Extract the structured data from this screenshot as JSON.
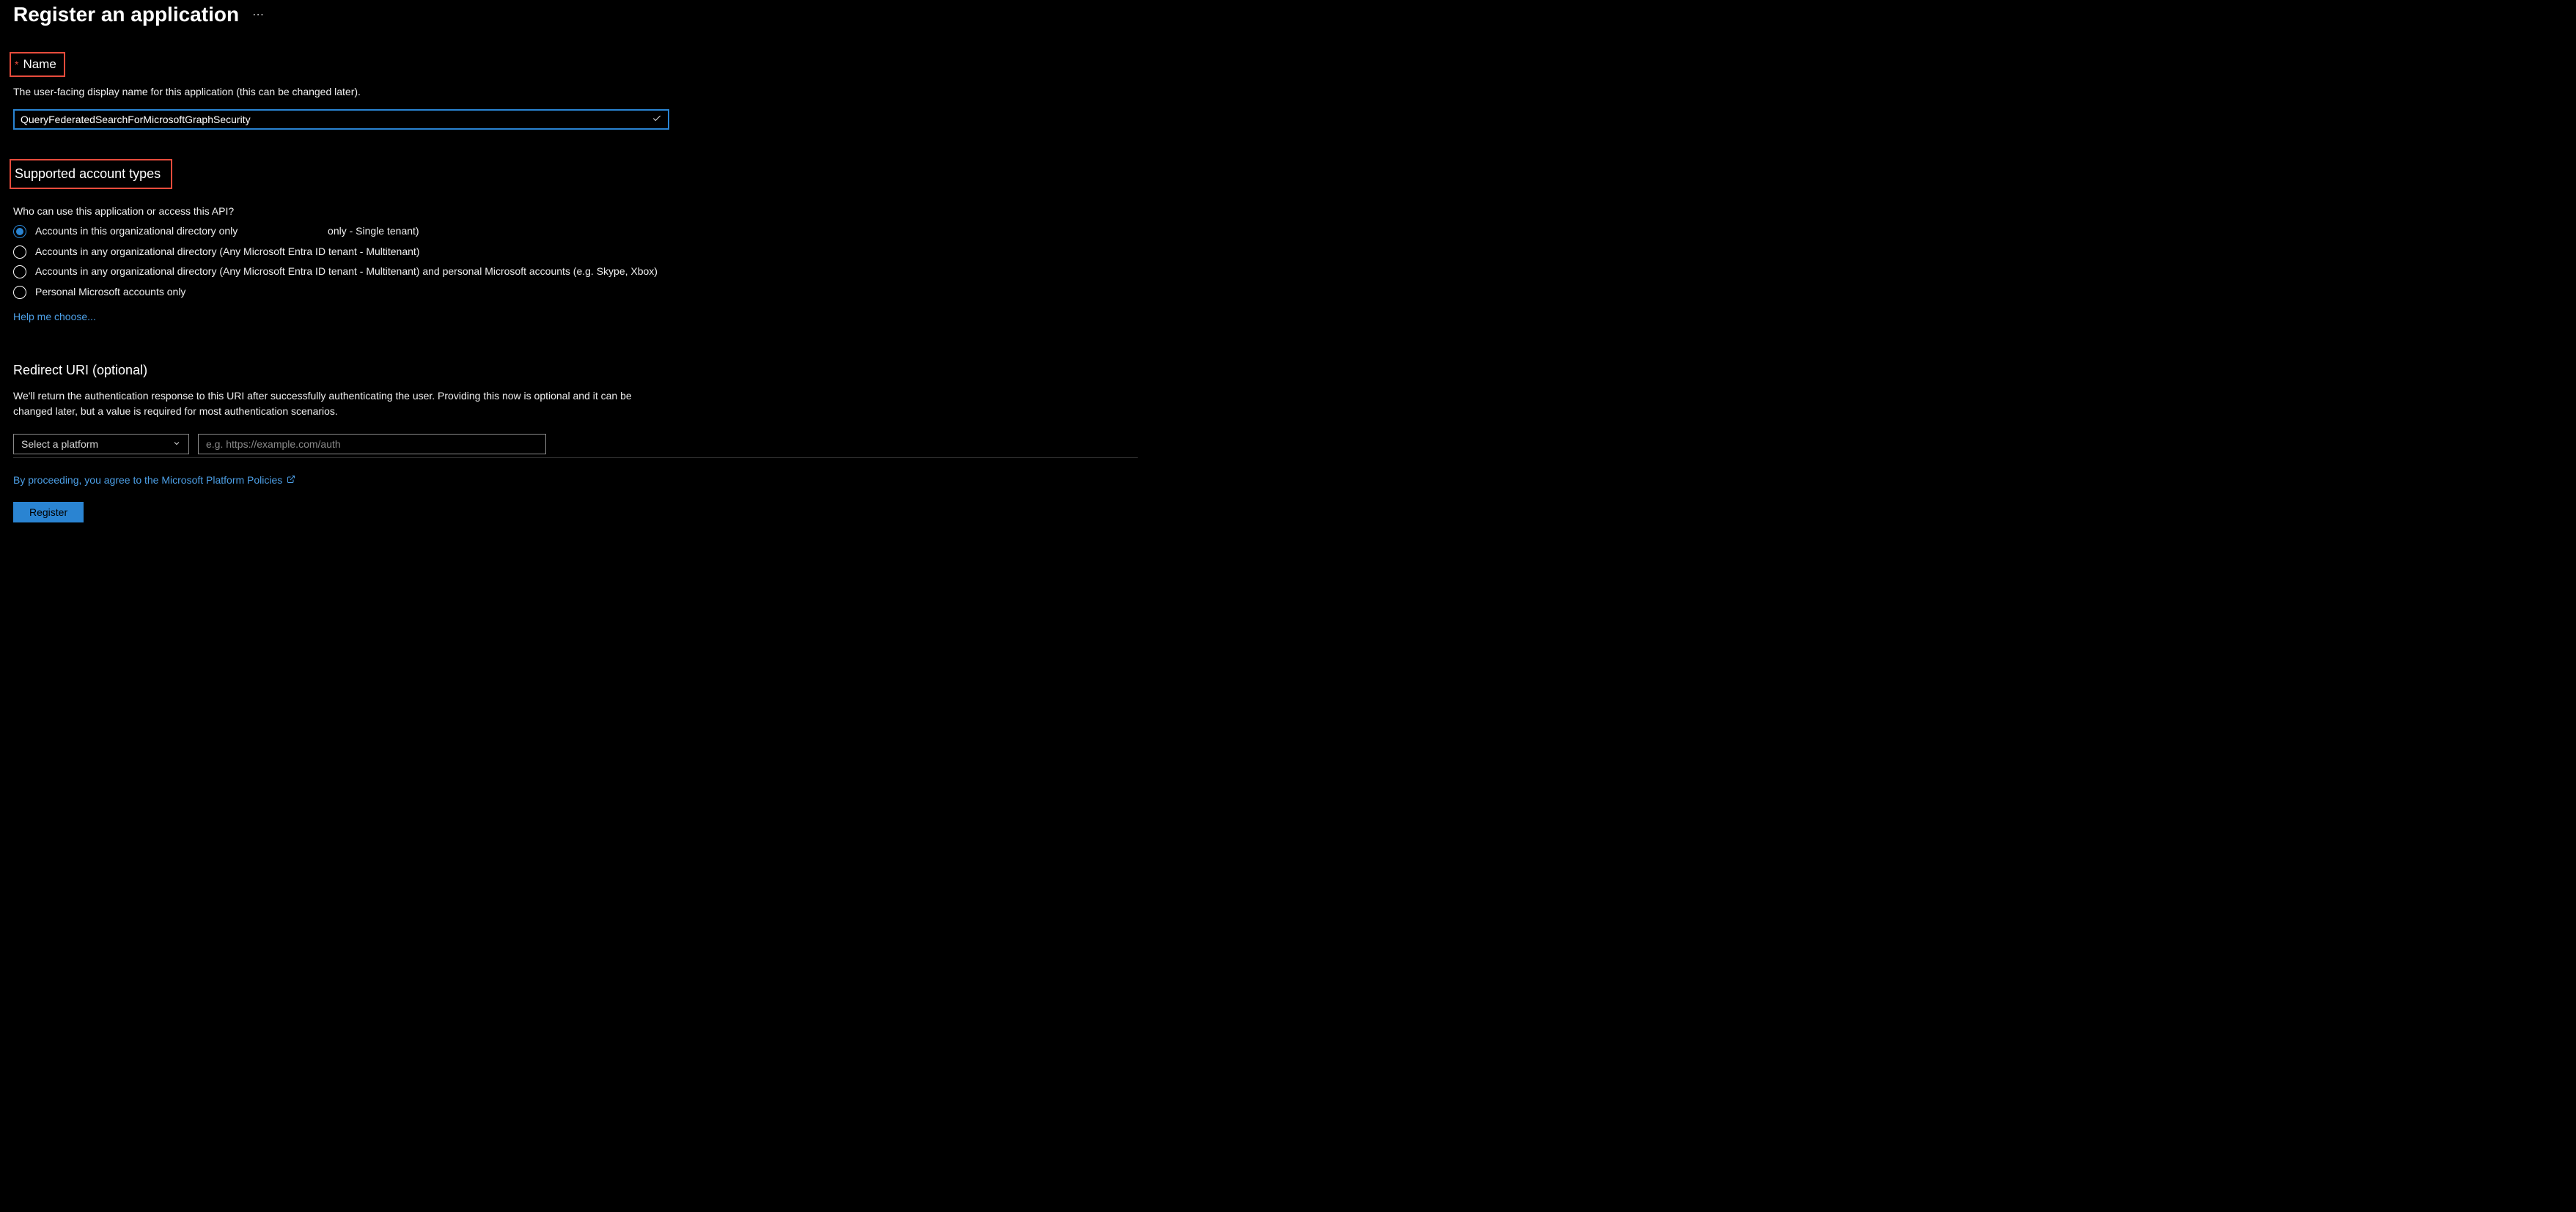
{
  "page": {
    "title": "Register an application"
  },
  "name_section": {
    "label": "Name",
    "hint": "The user-facing display name for this application (this can be changed later).",
    "value": "QueryFederatedSearchForMicrosoftGraphSecurity"
  },
  "accounts_section": {
    "heading": "Supported account types",
    "question": "Who can use this application or access this API?",
    "options": [
      {
        "label_prefix": "Accounts in this organizational directory only ",
        "label_suffix": " only - Single tenant)",
        "selected": true
      },
      {
        "label": "Accounts in any organizational directory (Any Microsoft Entra ID tenant - Multitenant)",
        "selected": false
      },
      {
        "label": "Accounts in any organizational directory (Any Microsoft Entra ID tenant - Multitenant) and personal Microsoft accounts (e.g. Skype, Xbox)",
        "selected": false
      },
      {
        "label": "Personal Microsoft accounts only",
        "selected": false
      }
    ],
    "help_link": "Help me choose..."
  },
  "redirect_section": {
    "heading": "Redirect URI (optional)",
    "description": "We'll return the authentication response to this URI after successfully authenticating the user. Providing this now is optional and it can be changed later, but a value is required for most authentication scenarios.",
    "platform_placeholder": "Select a platform",
    "uri_placeholder": "e.g. https://example.com/auth"
  },
  "footer": {
    "policies_text": "By proceeding, you agree to the Microsoft Platform Policies",
    "register_label": "Register"
  }
}
